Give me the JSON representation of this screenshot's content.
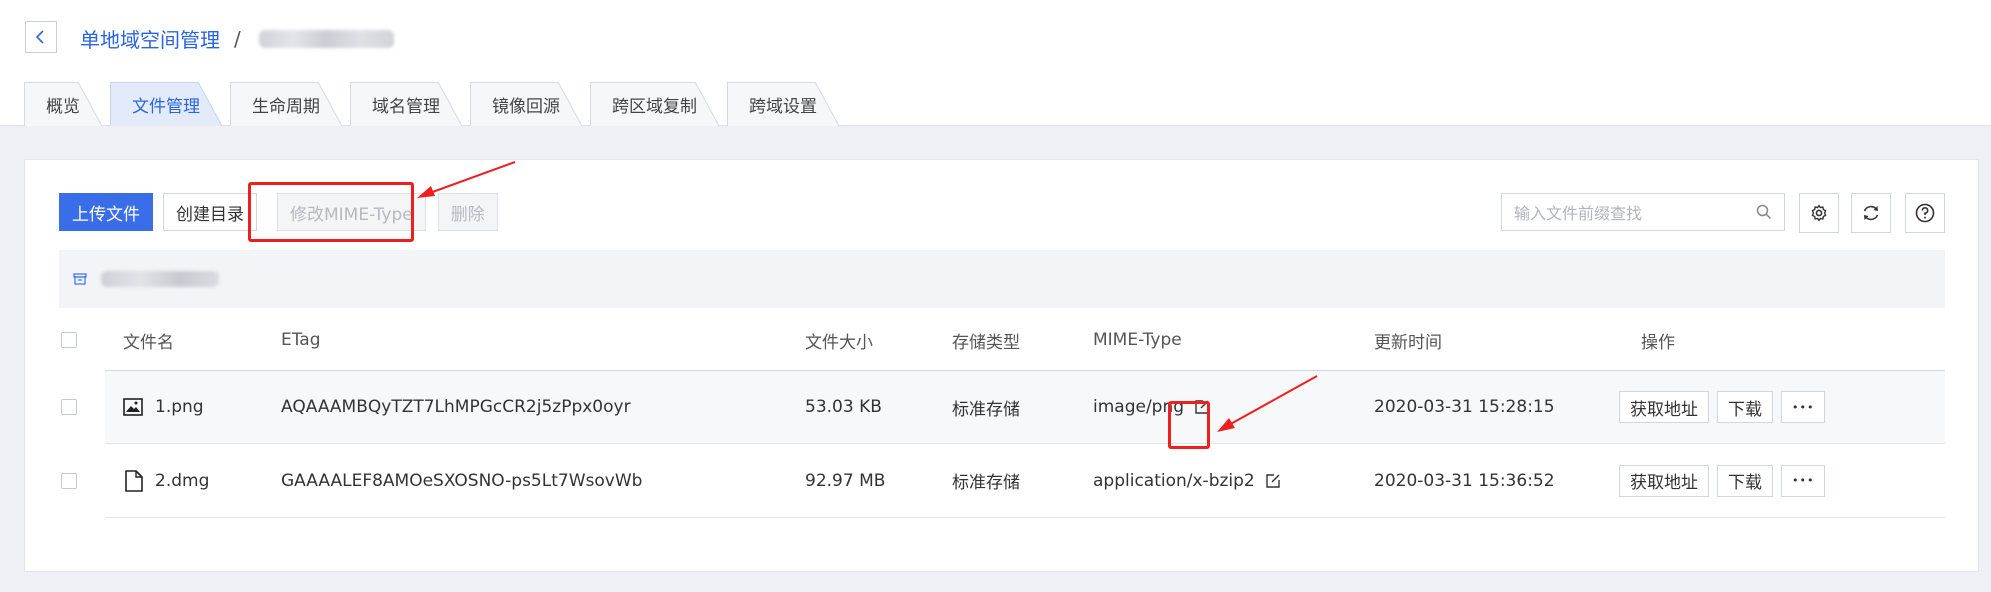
{
  "breadcrumb": {
    "parent": "单地域空间管理",
    "separator": "/"
  },
  "tabs": [
    {
      "label": "概览",
      "active": false
    },
    {
      "label": "文件管理",
      "active": true
    },
    {
      "label": "生命周期",
      "active": false
    },
    {
      "label": "域名管理",
      "active": false
    },
    {
      "label": "镜像回源",
      "active": false
    },
    {
      "label": "跨区域复制",
      "active": false
    },
    {
      "label": "跨域设置",
      "active": false
    }
  ],
  "toolbar": {
    "upload": "上传文件",
    "create_dir": "创建目录",
    "edit_mime": "修改MIME-Type",
    "delete": "删除"
  },
  "search": {
    "placeholder": "输入文件前缀查找"
  },
  "table": {
    "headers": {
      "name": "文件名",
      "etag": "ETag",
      "size": "文件大小",
      "storage": "存储类型",
      "mime": "MIME-Type",
      "updated": "更新时间",
      "actions": "操作"
    },
    "rows": [
      {
        "name": "1.png",
        "etag": "AQAAAMBQyTZT7LhMPGcCR2j5zPpx0oyr",
        "size": "53.03 KB",
        "storage": "标准存储",
        "mime": "image/png",
        "updated": "2020-03-31 15:28:15",
        "icon": "image-file-icon"
      },
      {
        "name": "2.dmg",
        "etag": "GAAAALEF8AMOeSXOSNO-ps5Lt7WsovWb",
        "size": "92.97 MB",
        "storage": "标准存储",
        "mime": "application/x-bzip2",
        "updated": "2020-03-31 15:36:52",
        "icon": "file-icon"
      }
    ],
    "row_actions": {
      "get_url": "获取地址",
      "download": "下载",
      "more": "•••"
    }
  },
  "colors": {
    "accent": "#2b64e0",
    "primary_button": "#3a6ee8",
    "highlight": "#ee1f1f"
  }
}
